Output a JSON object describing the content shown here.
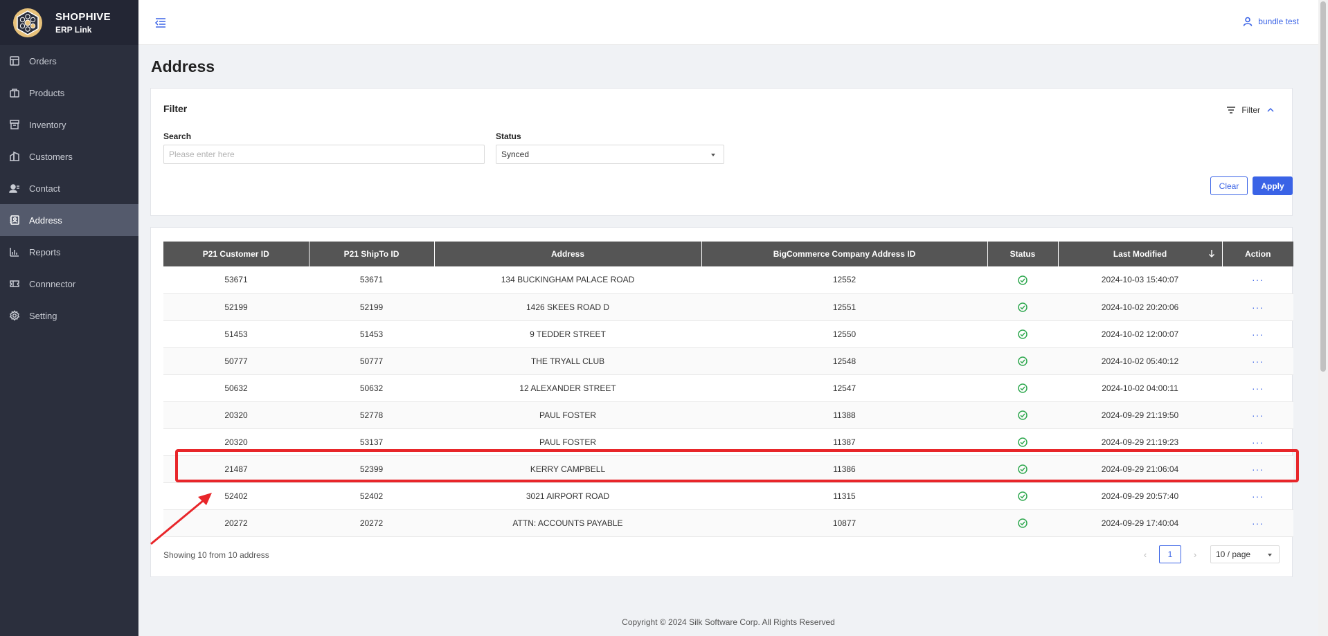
{
  "brand": {
    "name": "SHOPHIVE",
    "sub": "ERP Link"
  },
  "sidebar": {
    "items": [
      {
        "label": "Orders",
        "icon": "orders-icon"
      },
      {
        "label": "Products",
        "icon": "products-icon"
      },
      {
        "label": "Inventory",
        "icon": "inventory-icon"
      },
      {
        "label": "Customers",
        "icon": "customers-icon"
      },
      {
        "label": "Contact",
        "icon": "contact-icon"
      },
      {
        "label": "Address",
        "icon": "address-icon",
        "active": true
      },
      {
        "label": "Reports",
        "icon": "reports-icon"
      },
      {
        "label": "Connnector",
        "icon": "connector-icon"
      },
      {
        "label": "Setting",
        "icon": "gear-icon"
      }
    ]
  },
  "header": {
    "user": "bundle test"
  },
  "page": {
    "title": "Address"
  },
  "filter": {
    "title": "Filter",
    "toggle_label": "Filter",
    "search_label": "Search",
    "search_placeholder": "Please enter here",
    "search_value": "",
    "status_label": "Status",
    "status_value": "Synced",
    "clear_label": "Clear",
    "apply_label": "Apply"
  },
  "table": {
    "headers": [
      "P21 Customer ID",
      "P21 ShipTo ID",
      "Address",
      "BigCommerce Company Address ID",
      "Status",
      "Last Modified",
      "Action"
    ],
    "rows": [
      {
        "customer_id": "53671",
        "shipto_id": "53671",
        "address": "134 BUCKINGHAM PALACE ROAD",
        "bc_id": "12552",
        "status": "synced",
        "modified": "2024-10-03 15:40:07",
        "action": "···"
      },
      {
        "customer_id": "52199",
        "shipto_id": "52199",
        "address": "1426 SKEES ROAD D",
        "bc_id": "12551",
        "status": "synced",
        "modified": "2024-10-02 20:20:06",
        "action": "···"
      },
      {
        "customer_id": "51453",
        "shipto_id": "51453",
        "address": "9 TEDDER STREET",
        "bc_id": "12550",
        "status": "synced",
        "modified": "2024-10-02 12:00:07",
        "action": "···"
      },
      {
        "customer_id": "50777",
        "shipto_id": "50777",
        "address": "THE TRYALL CLUB",
        "bc_id": "12548",
        "status": "synced",
        "modified": "2024-10-02 05:40:12",
        "action": "···"
      },
      {
        "customer_id": "50632",
        "shipto_id": "50632",
        "address": "12 ALEXANDER STREET",
        "bc_id": "12547",
        "status": "synced",
        "modified": "2024-10-02 04:00:11",
        "action": "···"
      },
      {
        "customer_id": "20320",
        "shipto_id": "52778",
        "address": "PAUL FOSTER",
        "bc_id": "11388",
        "status": "synced",
        "modified": "2024-09-29 21:19:50",
        "action": "···"
      },
      {
        "customer_id": "20320",
        "shipto_id": "53137",
        "address": "PAUL FOSTER",
        "bc_id": "11387",
        "status": "synced",
        "modified": "2024-09-29 21:19:23",
        "action": "···"
      },
      {
        "customer_id": "21487",
        "shipto_id": "52399",
        "address": "KERRY CAMPBELL",
        "bc_id": "11386",
        "status": "synced",
        "modified": "2024-09-29 21:06:04",
        "action": "···"
      },
      {
        "customer_id": "52402",
        "shipto_id": "52402",
        "address": "3021 AIRPORT ROAD",
        "bc_id": "11315",
        "status": "synced",
        "modified": "2024-09-29 20:57:40",
        "action": "···"
      },
      {
        "customer_id": "20272",
        "shipto_id": "20272",
        "address": "ATTN: ACCOUNTS PAYABLE",
        "bc_id": "10877",
        "status": "synced",
        "modified": "2024-09-29 17:40:04",
        "action": "···"
      }
    ]
  },
  "pagination": {
    "showing": "Showing 10 from 10 address",
    "current_page": "1",
    "page_size": "10 / page"
  },
  "footer": {
    "copyright": "Copyright © 2024 Silk Software Corp. All Rights Reserved"
  },
  "colors": {
    "accent": "#3a63e6",
    "sidebar_bg": "#2b2f3d",
    "header_bg": "#555555",
    "success": "#2fa84f",
    "annotation": "#e8262a"
  }
}
